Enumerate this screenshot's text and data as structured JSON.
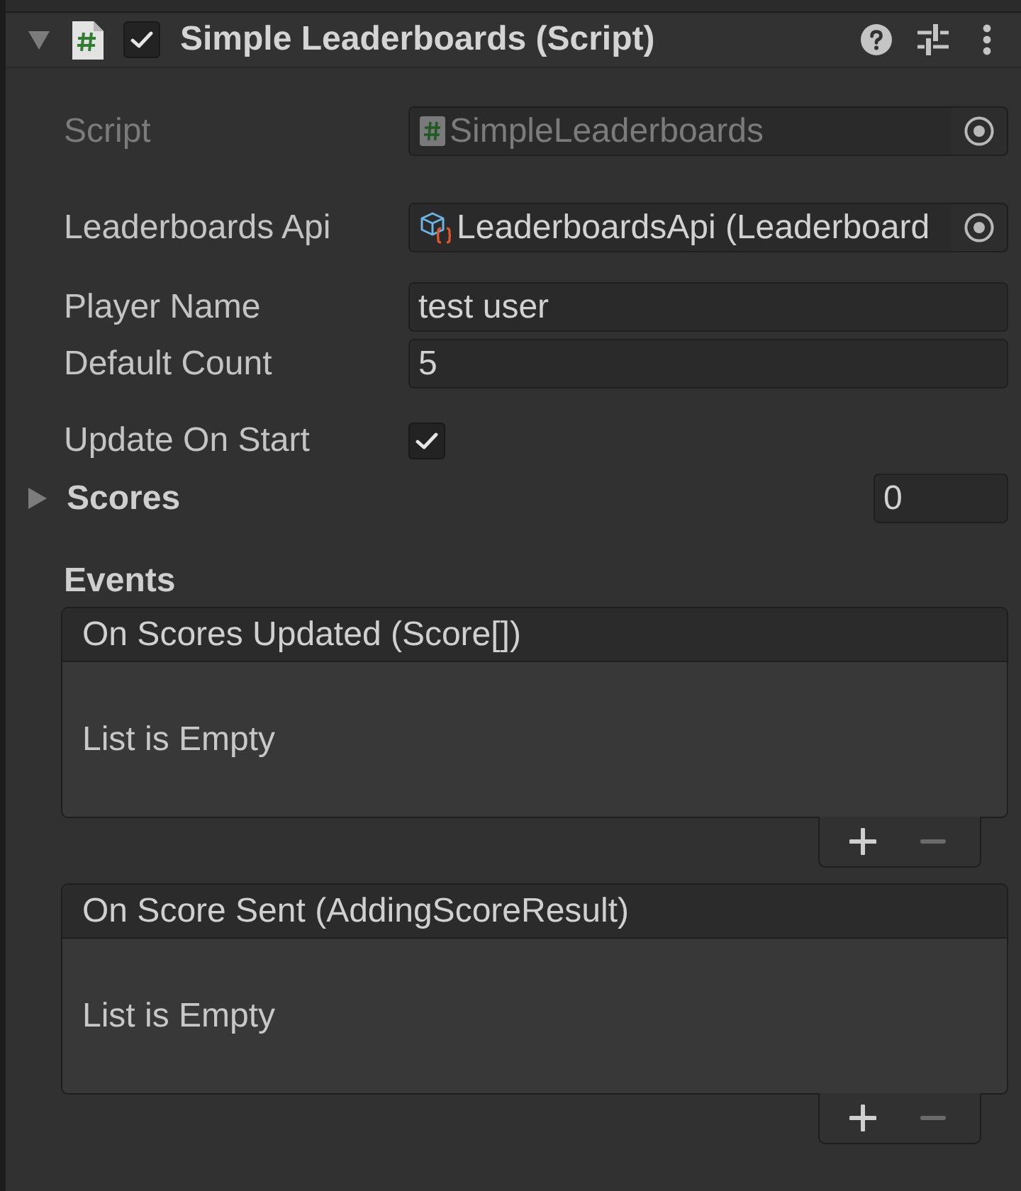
{
  "component": {
    "title": "Simple Leaderboards (Script)",
    "expanded": true,
    "enabled": true
  },
  "properties": [
    {
      "kind": "script_ref",
      "label": "Script",
      "value": "SimpleLeaderboards",
      "disabled": true
    },
    {
      "kind": "object_ref",
      "label": "Leaderboards Api",
      "value": "LeaderboardsApi (Leaderboard",
      "disabled": false
    },
    {
      "kind": "text",
      "label": "Player Name",
      "value": "test user"
    },
    {
      "kind": "text",
      "label": "Default Count",
      "value": "5"
    },
    {
      "kind": "toggle",
      "label": "Update On Start",
      "checked": true
    },
    {
      "kind": "foldout",
      "label": "Scores",
      "expanded": false,
      "value": "0"
    }
  ],
  "events": {
    "heading": "Events",
    "lists": [
      {
        "title": "On Scores Updated (Score[])",
        "empty_text": "List is Empty",
        "remove_disabled": true
      },
      {
        "title": "On Score Sent (AddingScoreResult)",
        "empty_text": "List is Empty",
        "remove_disabled": true
      }
    ]
  }
}
